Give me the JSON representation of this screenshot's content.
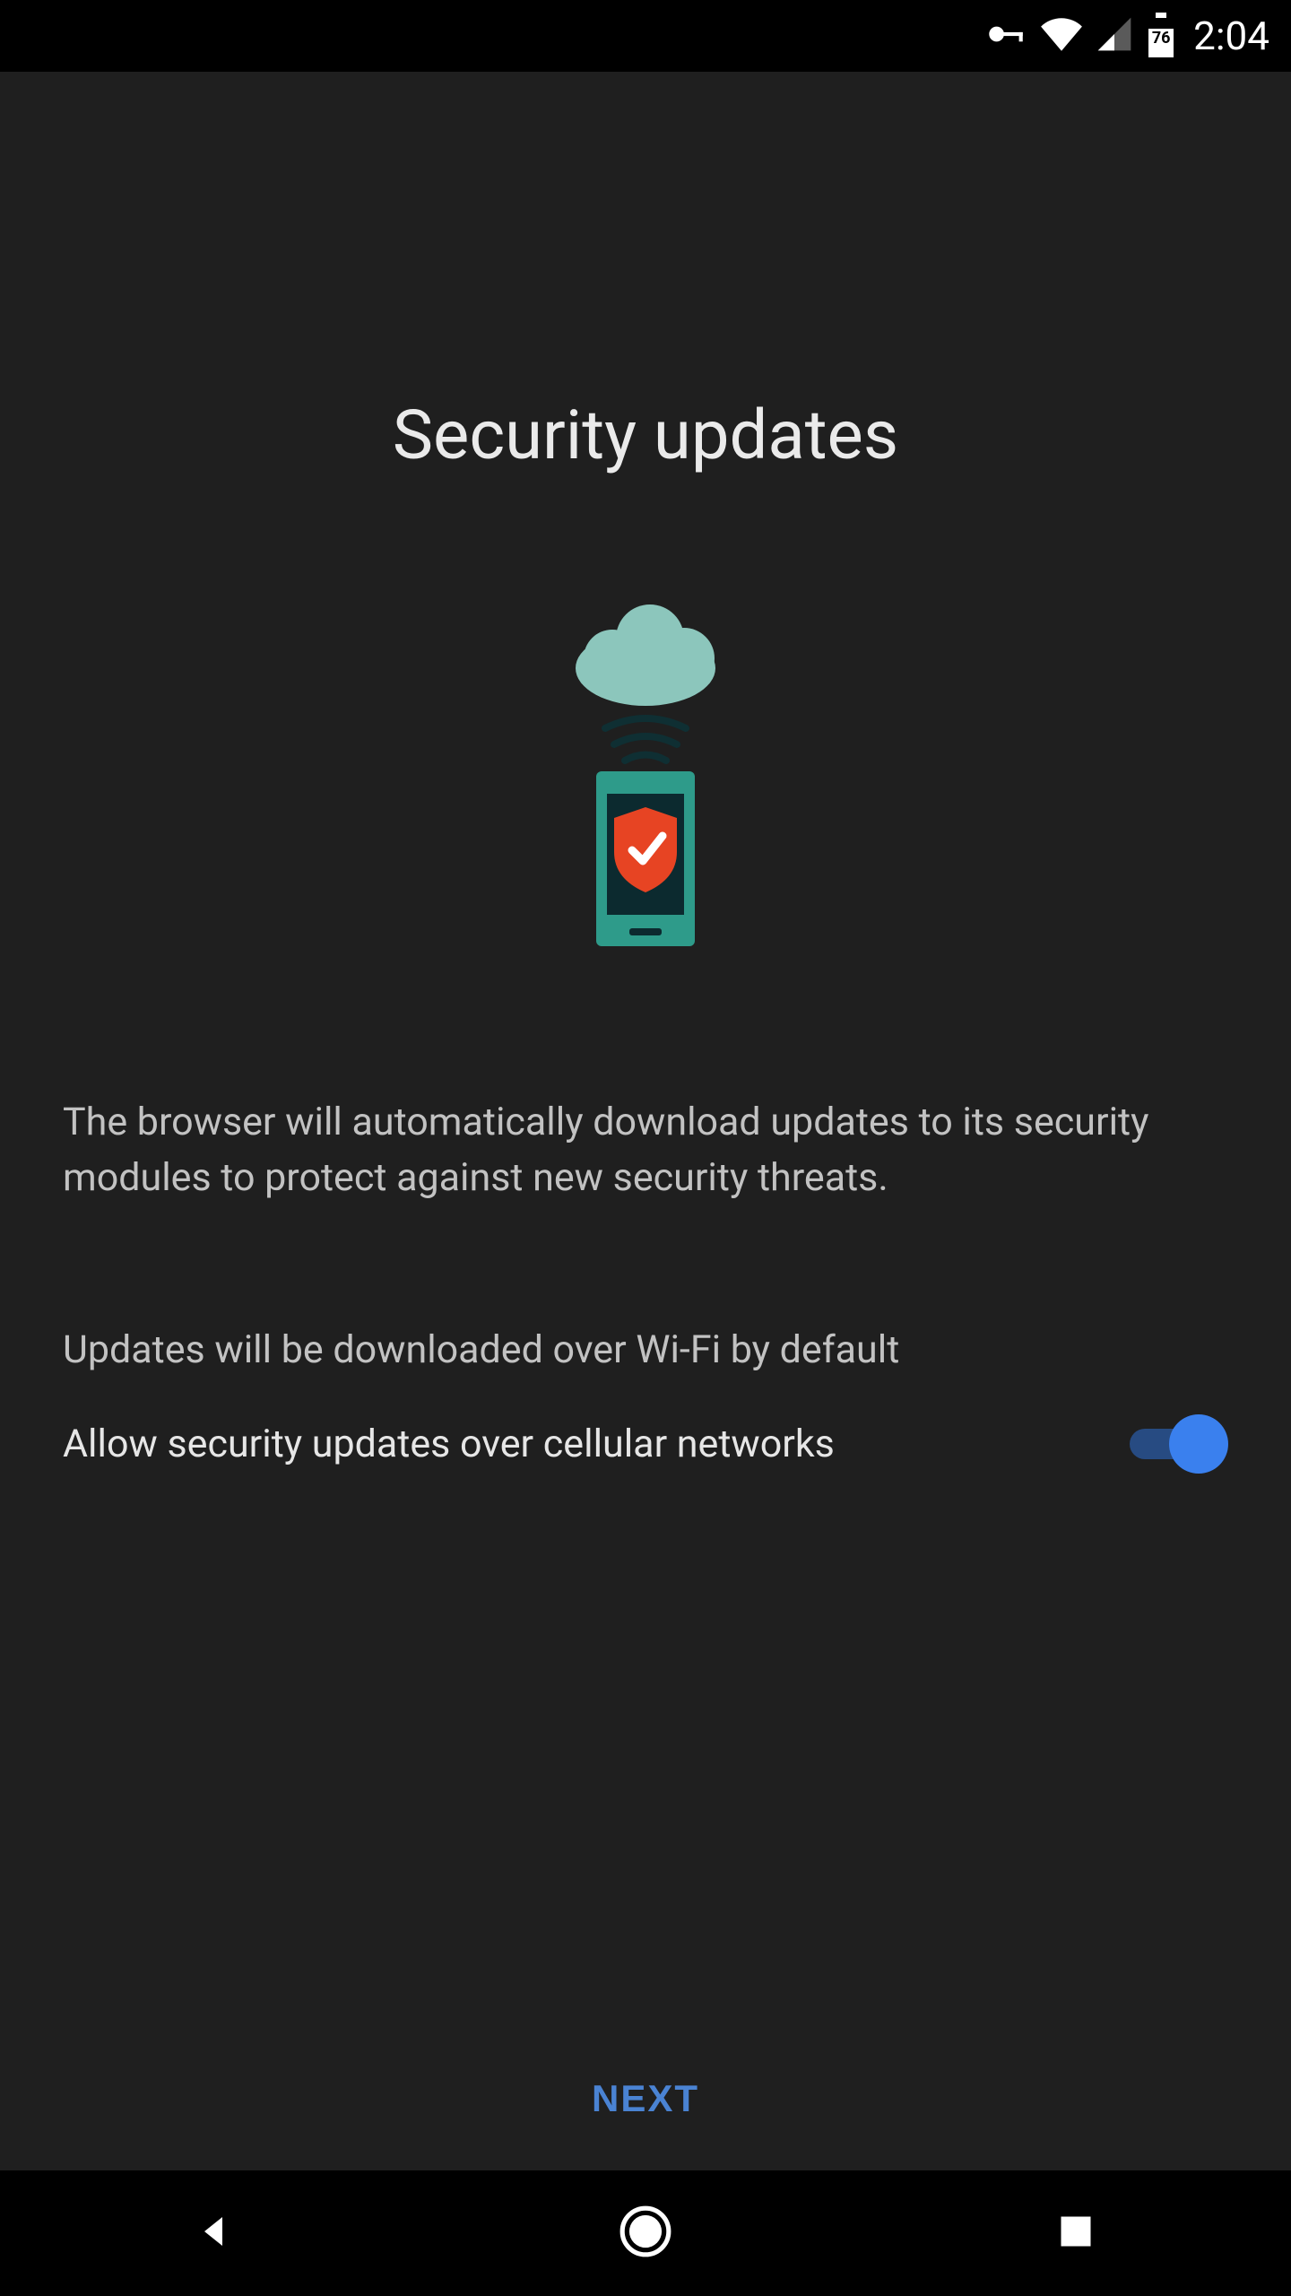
{
  "statusbar": {
    "battery_pct": "76",
    "time": "2:04"
  },
  "page": {
    "title": "Security updates",
    "description": "The browser will automatically download updates to its security modules to protect against new security threats.",
    "wifi_note": "Updates will be downloaded over Wi-Fi by default",
    "cellular_toggle_label": "Allow security updates over cellular networks",
    "cellular_toggle_on": true,
    "next_label": "NEXT"
  }
}
